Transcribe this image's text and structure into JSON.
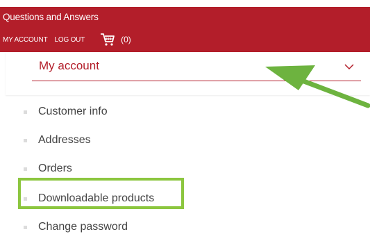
{
  "header": {
    "site_title": "Questions and Answers",
    "nav": {
      "my_account": "MY ACCOUNT",
      "log_out": "LOG OUT",
      "cart_icon": "shopping-cart-icon",
      "cart_count": "(0)"
    }
  },
  "account_select": {
    "label": "My account",
    "icon": "chevron-down-icon"
  },
  "menu": {
    "items": [
      {
        "label": "Customer info"
      },
      {
        "label": "Addresses"
      },
      {
        "label": "Orders"
      },
      {
        "label": "Downloadable products"
      },
      {
        "label": "Change password"
      }
    ]
  },
  "colors": {
    "brand_red": "#b31e2a",
    "annotation_green": "#8cc63f",
    "menu_text": "#444444"
  }
}
